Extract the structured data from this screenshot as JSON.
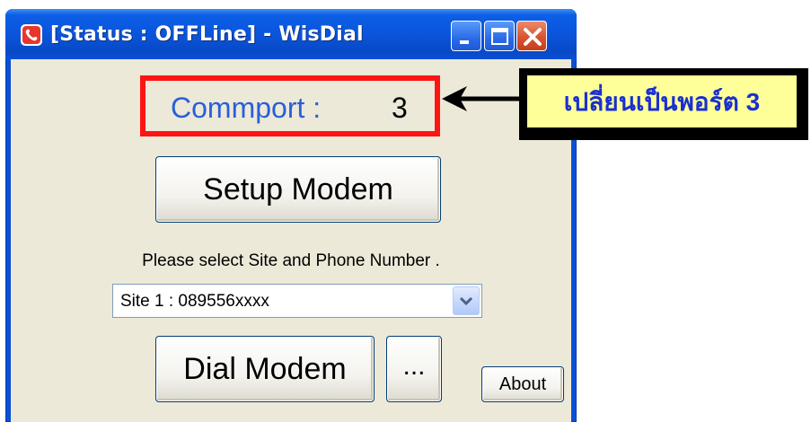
{
  "window": {
    "title": "[Status : OFFLine] - WisDial",
    "app_icon": "phone-handset-icon"
  },
  "commport": {
    "label": "Commport :",
    "value": "3"
  },
  "buttons": {
    "setup": "Setup Modem",
    "dial": "Dial Modem",
    "more": "...",
    "about": "About"
  },
  "site_prompt": "Please select Site and Phone Number .",
  "site_select": {
    "value": "Site 1 : 089556xxxx"
  },
  "callout": {
    "text": "เปลี่ยนเป็นพอร์ต 3"
  },
  "colors": {
    "highlight_border": "#ff1414",
    "commport_label": "#2a5fd8",
    "callout_bg": "#ffff99",
    "callout_text": "#1a2fd0",
    "titlebar": "#0a55dc"
  }
}
